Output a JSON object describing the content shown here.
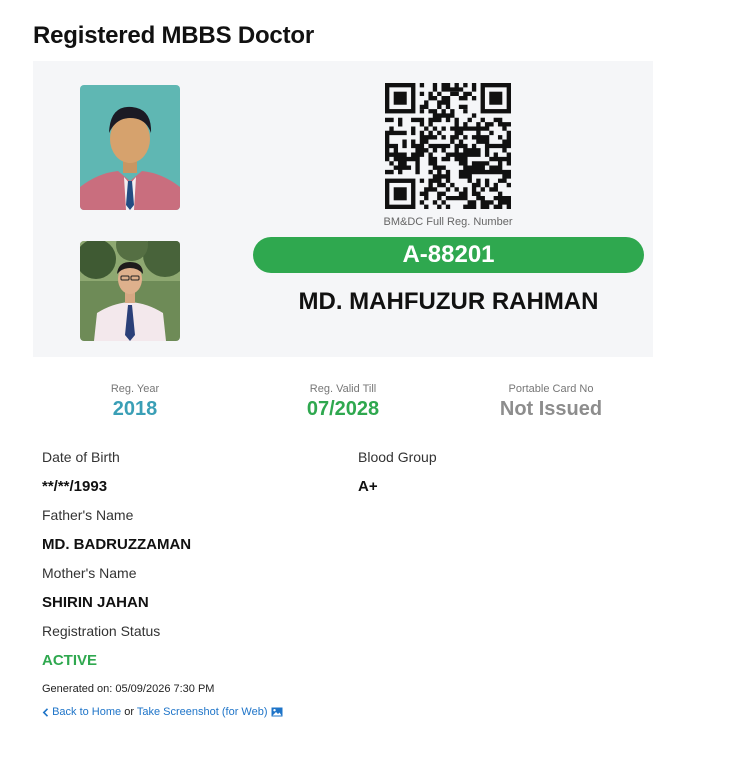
{
  "page": {
    "title": "Registered MBBS Doctor"
  },
  "card": {
    "reg_caption": "BM&DC Full Reg. Number",
    "reg_number": "A-88201",
    "doctor_name": "MD. MAHFUZUR RAHMAN"
  },
  "stats": {
    "reg_year": {
      "label": "Reg. Year",
      "value": "2018"
    },
    "valid_till": {
      "label": "Reg. Valid Till",
      "value": "07/2028"
    },
    "portable_card": {
      "label": "Portable Card No",
      "value": "Not Issued"
    }
  },
  "details": {
    "dob": {
      "label": "Date of Birth",
      "value": "**/**/1993"
    },
    "blood_group": {
      "label": "Blood Group",
      "value": "A+"
    },
    "father": {
      "label": "Father's Name",
      "value": "MD. BADRUZZAMAN"
    },
    "mother": {
      "label": "Mother's Name",
      "value": "SHIRIN JAHAN"
    },
    "status": {
      "label": "Registration Status",
      "value": "ACTIVE"
    }
  },
  "footer": {
    "generated": "Generated on: 05/09/2026 7:30 PM",
    "back_link": "Back to Home",
    "or_text": "or",
    "screenshot_link": "Take Screenshot (for Web)"
  },
  "icons": {
    "back": "chevron-left-icon",
    "screenshot": "image-icon",
    "qr": "qr-code"
  },
  "colors": {
    "accent_green": "#2fa84f",
    "accent_teal": "#3a9fb6",
    "muted_gray": "#8d8d8d",
    "link_blue": "#1e74c8",
    "card_bg": "#f5f6f8"
  }
}
